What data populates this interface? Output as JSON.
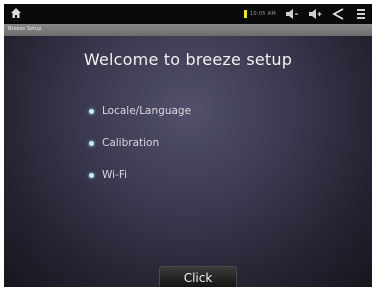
{
  "status_bar": {
    "time": "10:05 AM",
    "icons": [
      "home-icon",
      "signal-icon",
      "volume-down-icon",
      "volume-up-icon",
      "back-icon",
      "menu-icon"
    ]
  },
  "app_bar": {
    "title": "Breeze Setup"
  },
  "main": {
    "title": "Welcome to breeze setup",
    "items": [
      {
        "label": "Locale/Language"
      },
      {
        "label": "Calibration"
      },
      {
        "label": "Wi-Fi"
      }
    ],
    "button_label": "Click"
  },
  "colors": {
    "background_center": "#52506b",
    "background_edge": "#16161e",
    "bullet": "#cfe7f5",
    "signal": "#f4e23a",
    "app_bar": "#7a7a7a"
  }
}
